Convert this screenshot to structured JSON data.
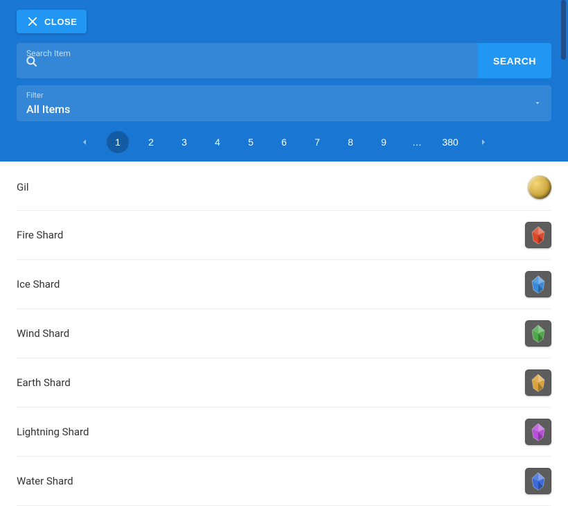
{
  "close": {
    "label": "CLOSE"
  },
  "search": {
    "label": "Search Item",
    "value": "",
    "button": "SEARCH"
  },
  "filter": {
    "label": "Filter",
    "value": "All Items"
  },
  "pagination": {
    "pages": [
      "1",
      "2",
      "3",
      "4",
      "5",
      "6",
      "7",
      "8",
      "9",
      "…",
      "380"
    ],
    "active": "1"
  },
  "items": [
    {
      "name": "Gil",
      "icon": "coin",
      "color": "#c9a43a"
    },
    {
      "name": "Fire Shard",
      "icon": "shard",
      "color": "#d9492a"
    },
    {
      "name": "Ice Shard",
      "icon": "shard",
      "color": "#3a8bd9"
    },
    {
      "name": "Wind Shard",
      "icon": "shard",
      "color": "#4fa84a"
    },
    {
      "name": "Earth Shard",
      "icon": "shard",
      "color": "#d9a23a"
    },
    {
      "name": "Lightning Shard",
      "icon": "shard",
      "color": "#b84fd9"
    },
    {
      "name": "Water Shard",
      "icon": "shard",
      "color": "#3a6bd9"
    }
  ]
}
